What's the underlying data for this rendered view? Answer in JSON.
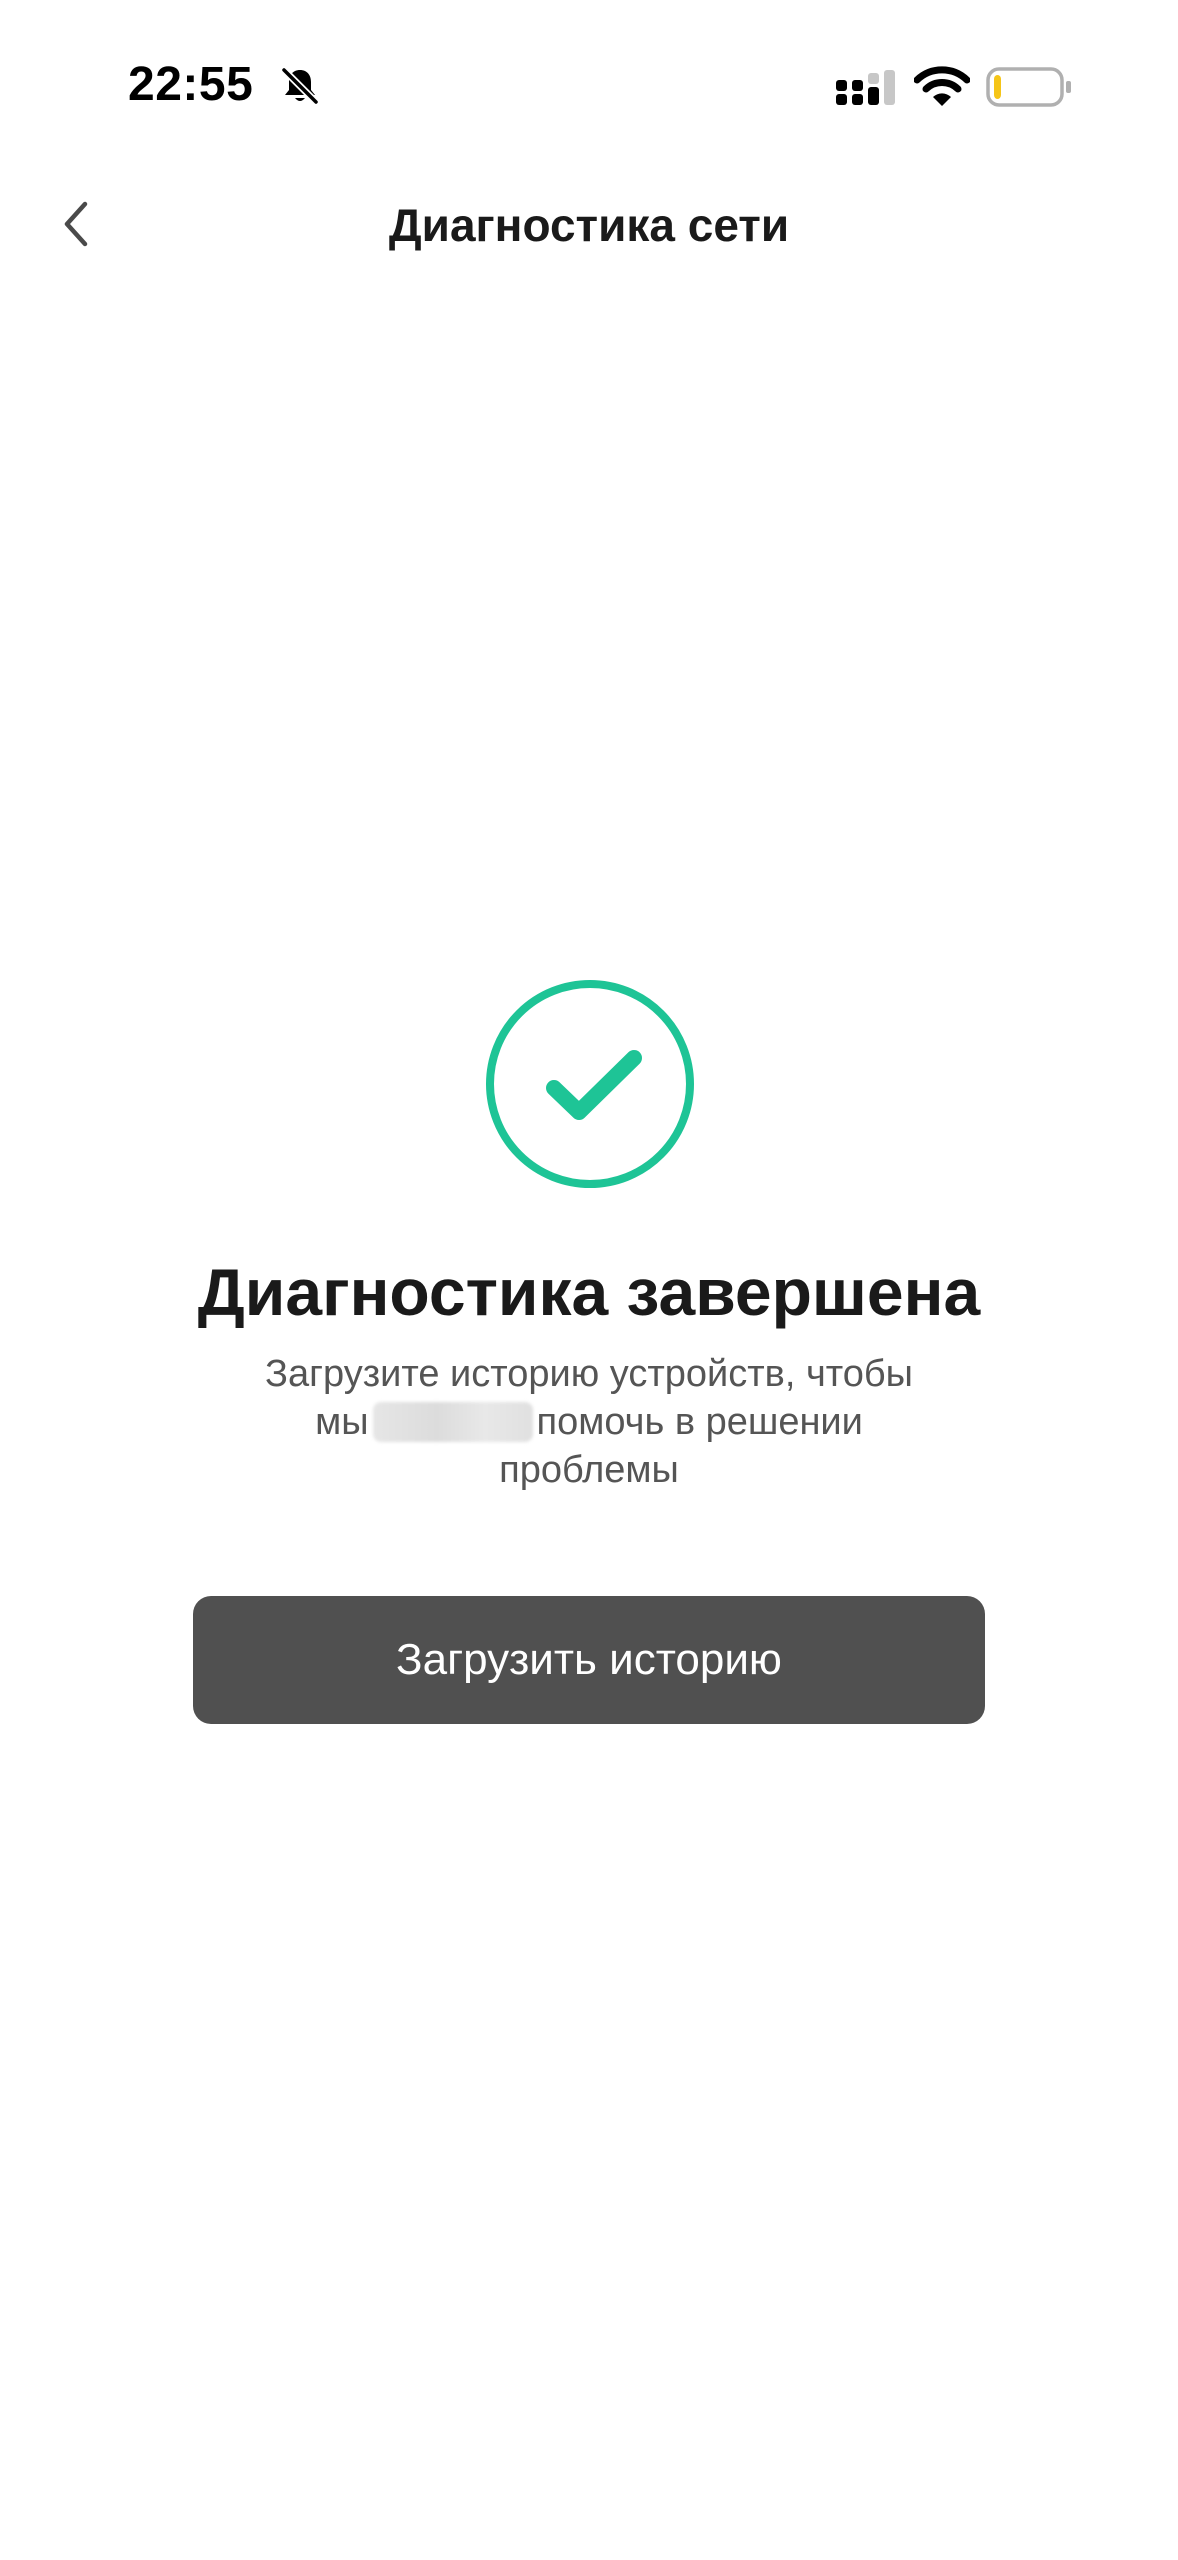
{
  "status_bar": {
    "time": "22:55",
    "mute_icon": "bell-slash-icon",
    "signal_icon": "cellular-signal-icon",
    "wifi_icon": "wifi-icon",
    "battery_icon": "battery-low-icon",
    "battery_fill_fraction": 0.12,
    "battery_color": "#f5c518"
  },
  "header": {
    "back_icon": "chevron-left-icon",
    "title": "Диагностика сети"
  },
  "result": {
    "icon": "check-circle-icon",
    "accent_color": "#1ec496",
    "title": "Диагностика завершена",
    "desc_line1": "Загрузите историю устройств, чтобы",
    "desc_prefix": "мы",
    "desc_suffix": "помочь в решении",
    "desc_line3": "проблемы"
  },
  "actions": {
    "upload_label": "Загрузить историю",
    "button_color": "#505050"
  }
}
